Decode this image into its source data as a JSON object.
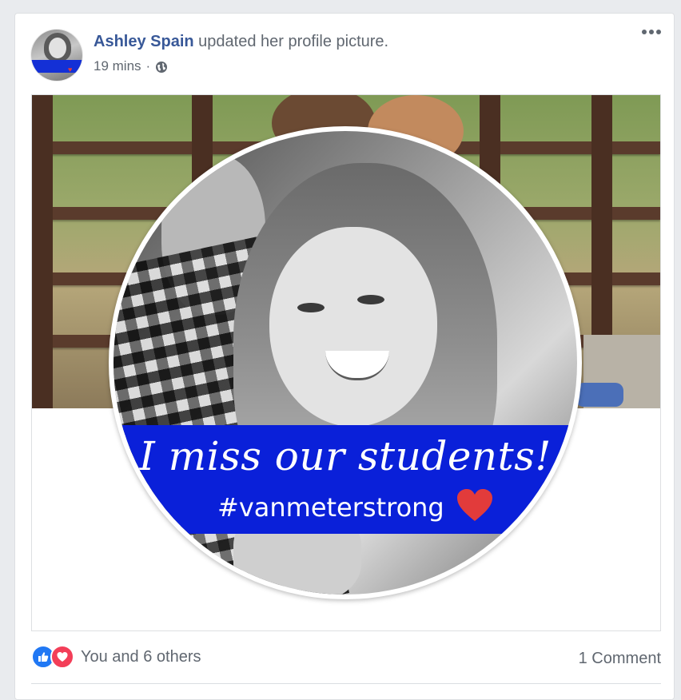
{
  "post": {
    "author_name": "Ashley Spain",
    "action_text": " updated her profile picture.",
    "timestamp": "19 mins",
    "separator": "·",
    "privacy_icon": "globe-icon",
    "more_icon": "more-horizontal-icon"
  },
  "profile_picture": {
    "banner_title": "I miss our students!",
    "banner_hashtag": "#vanmeterstrong",
    "heart_icon": "heart-icon",
    "banner_color": "#0a20d9",
    "heart_color": "#e23b3b"
  },
  "reactions": {
    "like_icon": "like-icon",
    "love_icon": "love-icon",
    "text": "You and 6 others",
    "comments": "1 Comment"
  },
  "colors": {
    "link": "#385898",
    "secondary_text": "#606770",
    "like": "#2078f4",
    "love": "#f33e58"
  }
}
